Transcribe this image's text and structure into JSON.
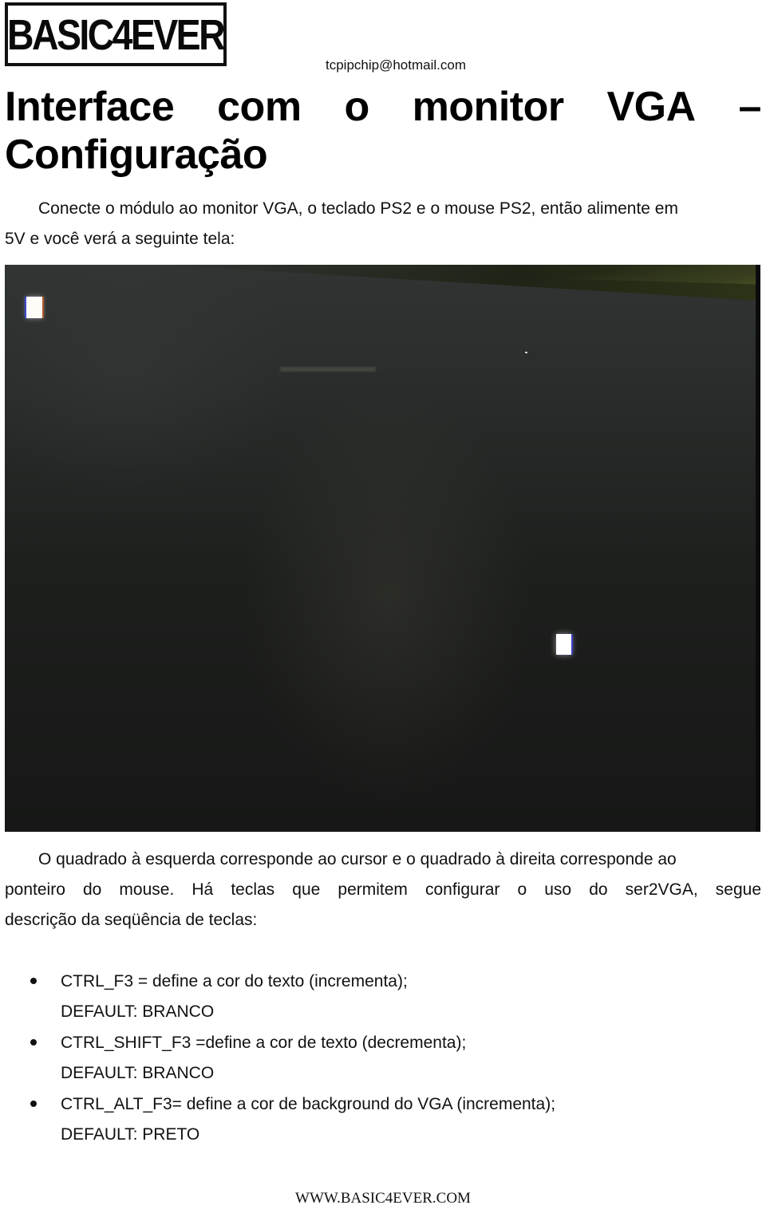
{
  "header": {
    "logo_text": "BASIC4EVER",
    "email": "tcpipchip@hotmail.com"
  },
  "title": {
    "line1_words": [
      "Interface",
      "com",
      "o",
      "monitor",
      "VGA",
      "–"
    ],
    "line2": "Configuração"
  },
  "intro": {
    "text_line1": "Conecte o módulo ao monitor VGA, o teclado PS2 e o mouse PS2, então alimente em",
    "text_line2": "5V e você verá a seguinte tela:"
  },
  "photo": {
    "description": "Photo of VGA monitor screen showing a cursor square (left) and mouse pointer square (right)",
    "colors": {
      "screen": "#1d1f1d",
      "bezel": "#6b7a2c",
      "square": "#ffffff"
    }
  },
  "explanation": {
    "text_line1": "O quadrado à esquerda corresponde ao cursor e o quadrado à direita corresponde ao",
    "text_line2": "ponteiro do mouse. Há teclas que permitem configurar o uso do ser2VGA, segue",
    "text_line3": "descrição da seqüência de teclas:"
  },
  "key_list": [
    {
      "line1": "CTRL_F3 = define a cor do texto (incrementa);",
      "line2": "DEFAULT: BRANCO"
    },
    {
      "line1": "CTRL_SHIFT_F3 =define a cor de texto (decrementa);",
      "line2": "DEFAULT: BRANCO"
    },
    {
      "line1": "CTRL_ALT_F3= define a cor de background do VGA (incrementa);",
      "line2": "DEFAULT: PRETO"
    }
  ],
  "footer": {
    "website": "WWW.BASIC4EVER.COM"
  }
}
